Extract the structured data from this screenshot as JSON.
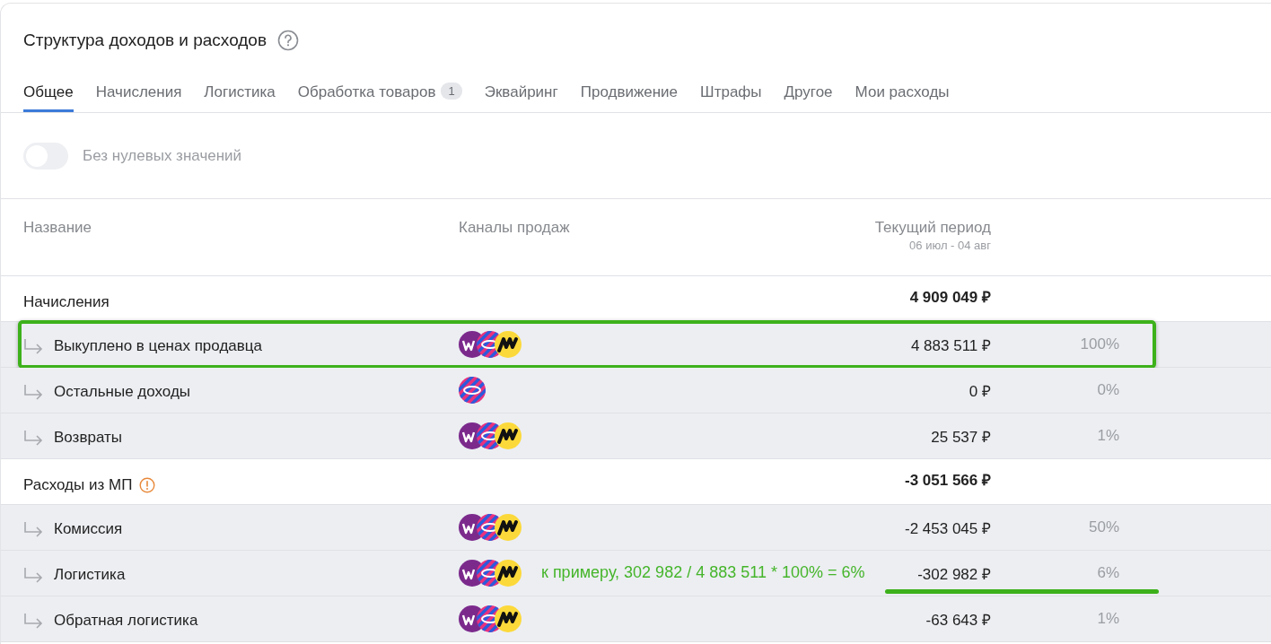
{
  "title": "Структура доходов и расходов",
  "tabs": [
    {
      "label": "Общее",
      "selected": true
    },
    {
      "label": "Начисления",
      "selected": false
    },
    {
      "label": "Логистика",
      "selected": false
    },
    {
      "label": "Обработка товаров",
      "selected": false,
      "badge": "1"
    },
    {
      "label": "Эквайринг",
      "selected": false
    },
    {
      "label": "Продвижение",
      "selected": false
    },
    {
      "label": "Штрафы",
      "selected": false
    },
    {
      "label": "Другое",
      "selected": false
    },
    {
      "label": "Мои расходы",
      "selected": false
    }
  ],
  "toggle": {
    "label": "Без нулевых значений",
    "on": false
  },
  "table": {
    "columns": [
      "Название",
      "Каналы продаж",
      "Текущий период"
    ],
    "period": "06 июл - 04 авг",
    "rows": [
      {
        "kind": "group",
        "name": "Начисления",
        "amount": "4 909 049 ₽"
      },
      {
        "kind": "item",
        "name": "Выкуплено в ценах продавца",
        "channels": [
          {
            "kind": "wb"
          },
          {
            "kind": "ozon"
          },
          {
            "kind": "ym"
          }
        ],
        "amount": "4 883 511 ₽",
        "share": "100%",
        "highlighted": true
      },
      {
        "kind": "item",
        "name": "Остальные доходы",
        "channels": [
          {
            "kind": "ozon"
          }
        ],
        "amount": "0 ₽",
        "share": "0%"
      },
      {
        "kind": "item",
        "name": "Возвраты",
        "channels": [
          {
            "kind": "wb"
          },
          {
            "kind": "ozon"
          },
          {
            "kind": "ym"
          }
        ],
        "amount": "25 537 ₽",
        "share": "1%"
      },
      {
        "kind": "group",
        "name": "Расходы из МП",
        "warning": true,
        "amount": "-3 051 566 ₽"
      },
      {
        "kind": "item",
        "name": "Комиссия",
        "channels": [
          {
            "kind": "wb"
          },
          {
            "kind": "ozon"
          },
          {
            "kind": "ym"
          }
        ],
        "amount": "-2 453 045 ₽",
        "share": "50%"
      },
      {
        "kind": "item",
        "name": "Логистика",
        "channels": [
          {
            "kind": "wb"
          },
          {
            "kind": "ozon"
          },
          {
            "kind": "ym"
          }
        ],
        "amount": "-302 982 ₽",
        "share": "6%",
        "note": "к примеру, 302 982 / 4 883 511 * 100% = 6%",
        "underlined": true
      },
      {
        "kind": "item",
        "name": "Обратная логистика",
        "channels": [
          {
            "kind": "wb"
          },
          {
            "kind": "ozon"
          },
          {
            "kind": "ym"
          }
        ],
        "amount": "-63 643 ₽",
        "share": "1%"
      }
    ]
  }
}
